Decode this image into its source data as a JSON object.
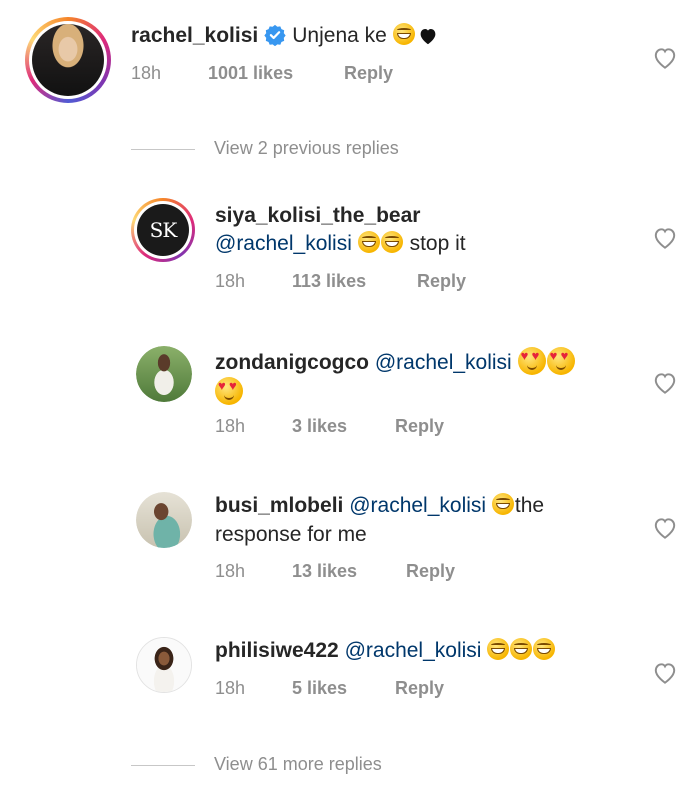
{
  "comments": [
    {
      "username": "rachel_kolisi",
      "verified": true,
      "text": "Unjena ke",
      "emojis": [
        "laughing-emoji",
        "black-heart"
      ],
      "time": "18h",
      "likes": "1001 likes",
      "reply": "Reply"
    },
    {
      "username": "siya_kolisi_the_bear",
      "avatar_text": "SK",
      "mention": "@rachel_kolisi",
      "emojis": [
        "laughing-emoji",
        "laughing-emoji"
      ],
      "text": "stop it",
      "time": "18h",
      "likes": "113 likes",
      "reply": "Reply"
    },
    {
      "username": "zondanigcogco",
      "mention": "@rachel_kolisi",
      "emojis": [
        "heart-eyes-emoji",
        "heart-eyes-emoji",
        "heart-eyes-emoji"
      ],
      "time": "18h",
      "likes": "3 likes",
      "reply": "Reply"
    },
    {
      "username": "busi_mlobeli",
      "mention": "@rachel_kolisi",
      "emojis": [
        "laughing-emoji"
      ],
      "text1": "the",
      "text2": "response for me",
      "time": "18h",
      "likes": "13 likes",
      "reply": "Reply"
    },
    {
      "username": "philisiwe422",
      "mention": "@rachel_kolisi",
      "emojis": [
        "laughing-emoji",
        "laughing-emoji",
        "laughing-emoji"
      ],
      "time": "18h",
      "likes": "5 likes",
      "reply": "Reply"
    }
  ],
  "view_previous": "View 2 previous replies",
  "view_more": "View 61 more replies",
  "colors": {
    "username": "#262626",
    "mention": "#00376b",
    "meta": "#8e8e8e",
    "verified": "#3897f0"
  }
}
